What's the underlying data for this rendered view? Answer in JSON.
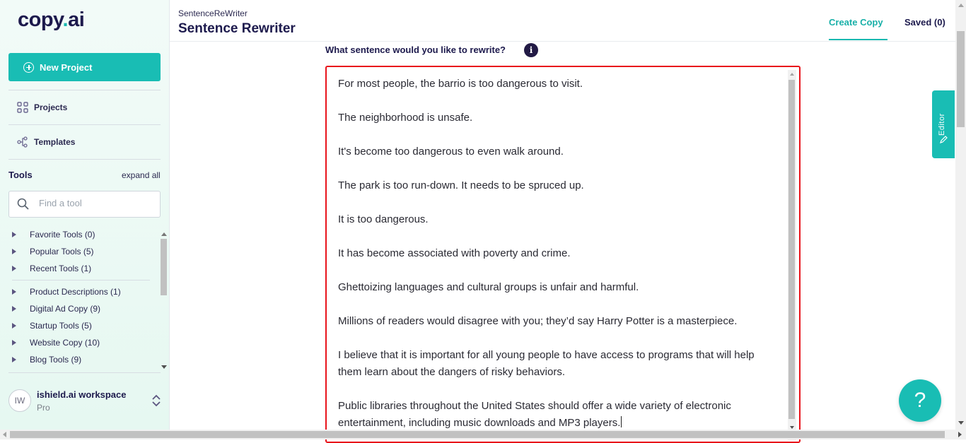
{
  "brand": {
    "name": "copy",
    "dot": ".",
    "suffix": "ai",
    "accent": "#19bdb4",
    "navy": "#1d1a4d"
  },
  "sidebar": {
    "new_project": "New Project",
    "nav": [
      {
        "label": "Projects",
        "icon": "grid-icon"
      },
      {
        "label": "Templates",
        "icon": "share-nodes-icon"
      }
    ],
    "tools_heading": "Tools",
    "expand_all": "expand all",
    "search_placeholder": "Find a tool",
    "tool_groups": [
      "Favorite Tools (0)",
      "Popular Tools (5)",
      "Recent Tools (1)",
      "Product Descriptions (1)",
      "Digital Ad Copy (9)",
      "Startup Tools (5)",
      "Website Copy (10)",
      "Blog Tools (9)"
    ],
    "workspace": {
      "initials": "IW",
      "name": "ishield.ai workspace",
      "plan": "Pro"
    }
  },
  "header": {
    "breadcrumb": "SentenceReWriter",
    "title": "Sentence Rewriter",
    "tabs": {
      "create": "Create Copy",
      "saved": "Saved (0)"
    }
  },
  "main": {
    "question": "What sentence would you like to rewrite?",
    "info": "i",
    "sentences": [
      "For most people, the barrio is too dangerous to visit.",
      "The neighborhood is unsafe.",
      "It's become too dangerous to even walk around.",
      "The park is too run-down. It needs to be spruced up.",
      "It is too dangerous.",
      "It has become associated with poverty and crime.",
      "Ghettoizing languages and cultural groups is unfair and harmful.",
      "Millions of readers would disagree with you; they’d say Harry Potter is a masterpiece.",
      "I believe that it is important for all young people to have access to programs that will help them learn about the dangers of risky behaviors.",
      "Public libraries throughout the United States should offer a wide variety of electronic entertainment, including music downloads and MP3 players."
    ]
  },
  "side_tab": "Editor",
  "help": "?"
}
